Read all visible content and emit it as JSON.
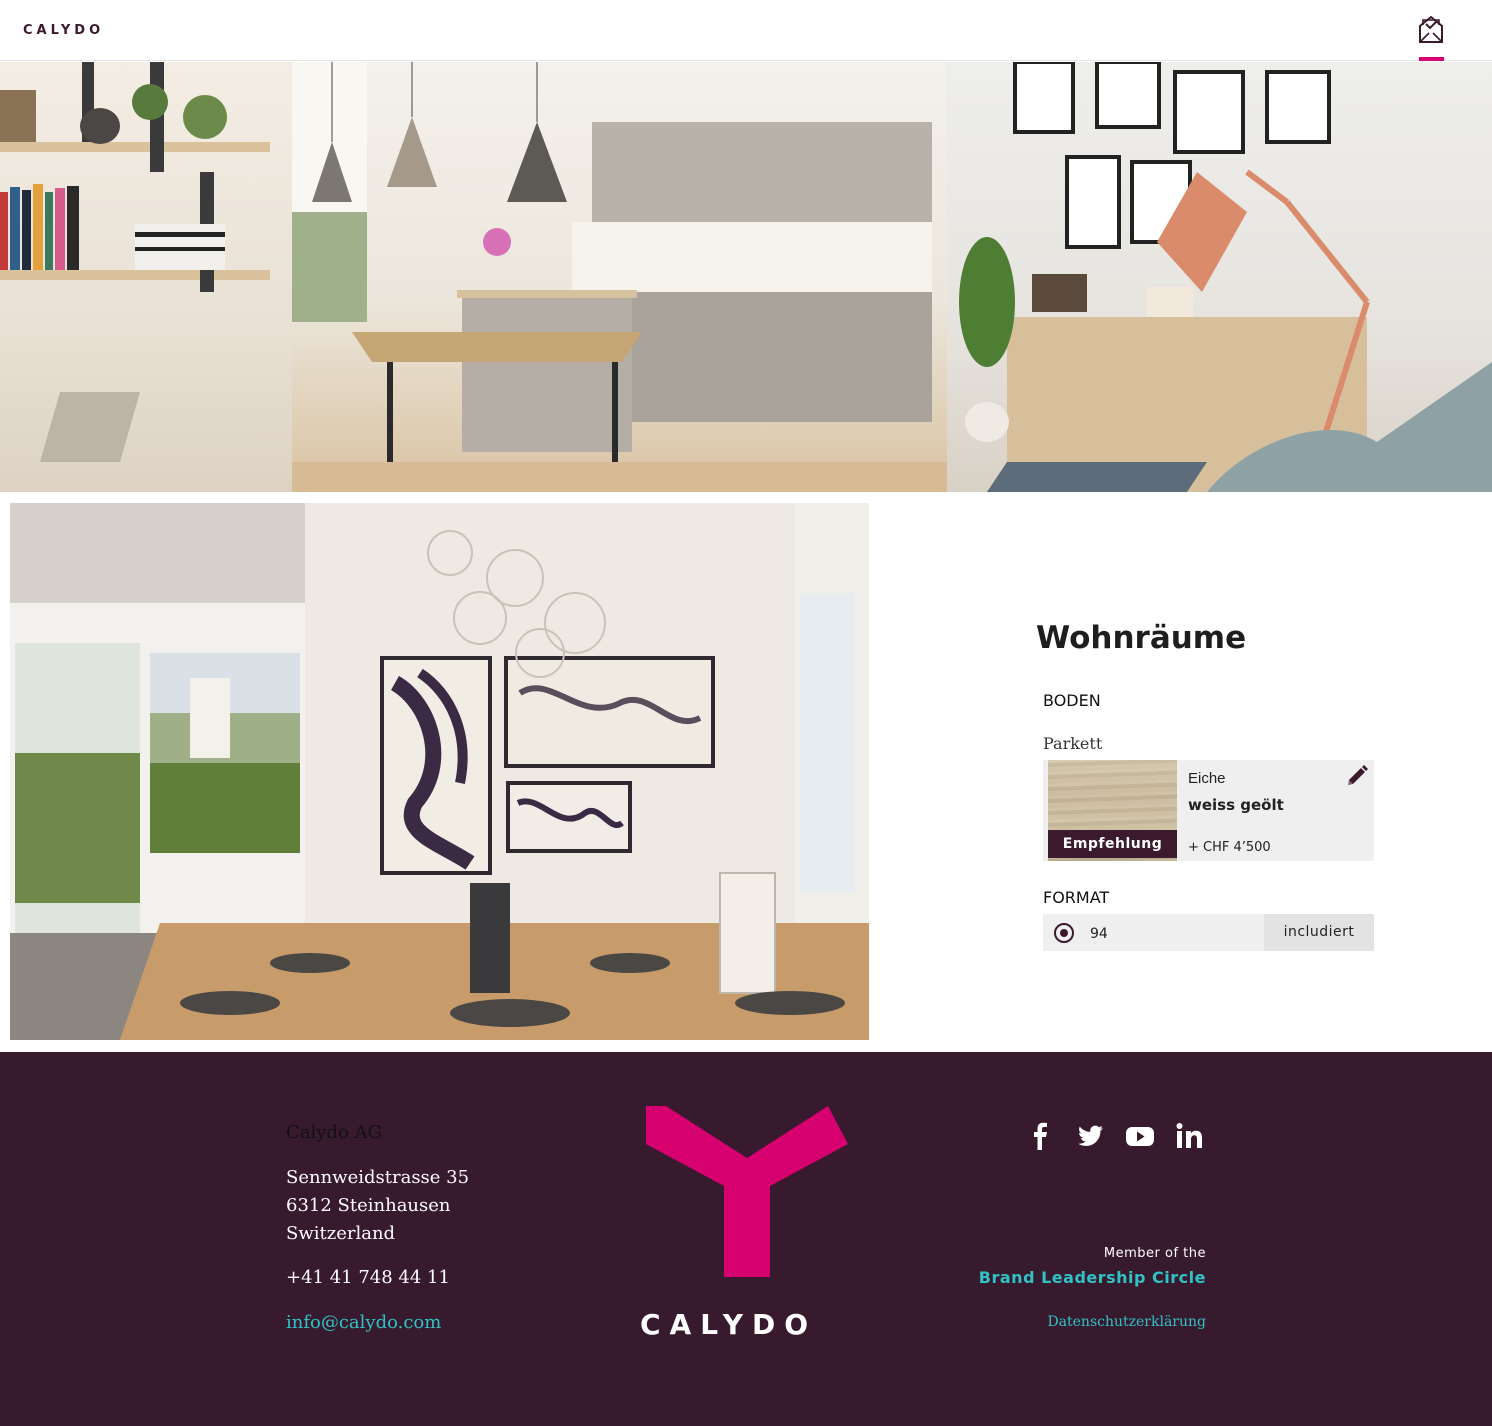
{
  "header": {
    "logo_text": "CALYDO",
    "mail_icon": "mail-check-icon"
  },
  "hero": {
    "image_description_icon": "interior-photo"
  },
  "config": {
    "title": "Wohnräume",
    "floor_section": "BODEN",
    "floor_subsection": "Parkett",
    "option": {
      "name": "Eiche",
      "variant": "weiss geölt",
      "price": "+ CHF 4’500",
      "badge": "Empfehlung",
      "edit_icon": "pencil-icon"
    },
    "format_section": "FORMAT",
    "format_option": {
      "value": "94",
      "status": "includiert",
      "selected": true
    }
  },
  "footer": {
    "company": "Calydo AG",
    "street": "Sennweidstrasse 35",
    "city": "6312 Steinhausen",
    "country": "Switzerland",
    "phone": "+41 41 748 44 11",
    "email": "info@calydo.com",
    "brand_word": "CALYDO",
    "social": [
      "facebook-icon",
      "twitter-icon",
      "youtube-icon",
      "linkedin-icon"
    ],
    "member_of": "Member of the",
    "circle": "Brand Leadership Circle",
    "privacy": "Datenschutzerklärung"
  },
  "colors": {
    "brand_plum": "#381a2f",
    "accent_magenta": "#d6006f",
    "link_teal": "#2fc3c6"
  }
}
